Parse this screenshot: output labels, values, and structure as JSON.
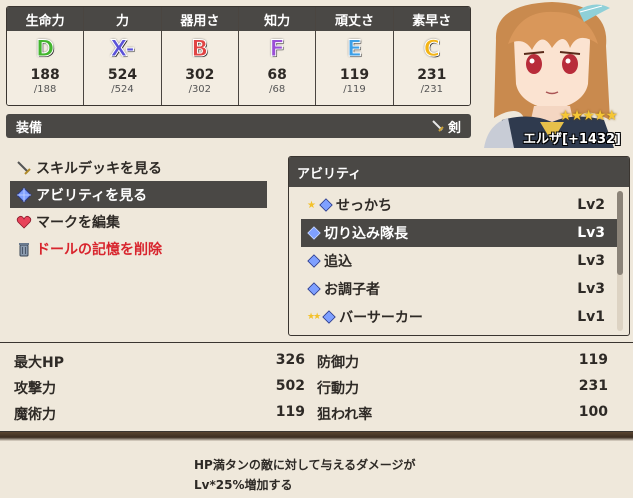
{
  "stats": [
    {
      "label": "生命力",
      "grade": "D",
      "grade_color": "#43b52e",
      "value": "188",
      "max": "/188"
    },
    {
      "label": "力",
      "grade": "X-",
      "grade_color": "#5b52d8",
      "value": "524",
      "max": "/524"
    },
    {
      "label": "器用さ",
      "grade": "B",
      "grade_color": "#e04444",
      "value": "302",
      "max": "/302"
    },
    {
      "label": "知力",
      "grade": "F",
      "grade_color": "#9a4fd6",
      "value": "68",
      "max": "/68"
    },
    {
      "label": "頑丈さ",
      "grade": "E",
      "grade_color": "#3c9fe6",
      "value": "119",
      "max": "/119"
    },
    {
      "label": "素早さ",
      "grade": "C",
      "grade_color": "#f3b416",
      "value": "231",
      "max": "/231"
    }
  ],
  "equipment": {
    "label": "装備",
    "value": "剣",
    "icon": "sword-icon"
  },
  "character": {
    "name": "エルザ[+1432]",
    "stars": "★★★★★",
    "star_count": 5
  },
  "menu": [
    {
      "label": "スキルデッキを見る",
      "icon": "sword-icon",
      "selected": false
    },
    {
      "label": "アビリティを見る",
      "icon": "diamond-icon",
      "selected": true
    },
    {
      "label": "マークを編集",
      "icon": "heart-icon",
      "selected": false
    },
    {
      "label": "ドールの記憶を削除",
      "icon": "trash-icon",
      "selected": false
    }
  ],
  "ability_panel": {
    "title": "アビリティ",
    "items": [
      {
        "name": "せっかち",
        "level": "Lv2",
        "badge": "★",
        "selected": false
      },
      {
        "name": "切り込み隊長",
        "level": "Lv3",
        "badge": "",
        "selected": true
      },
      {
        "name": "追込",
        "level": "Lv3",
        "badge": "",
        "selected": false
      },
      {
        "name": "お調子者",
        "level": "Lv3",
        "badge": "",
        "selected": false
      },
      {
        "name": "バーサーカー",
        "level": "Lv1",
        "badge": "★★",
        "selected": false
      }
    ]
  },
  "bottom_stats": [
    [
      {
        "label": "最大HP",
        "value": "326"
      },
      {
        "label": "防御力",
        "value": "119"
      }
    ],
    [
      {
        "label": "攻撃力",
        "value": "502"
      },
      {
        "label": "行動力",
        "value": "231"
      }
    ],
    [
      {
        "label": "魔術力",
        "value": "119"
      },
      {
        "label": "狙われ率",
        "value": "100"
      }
    ]
  ],
  "description": {
    "line1": "HP満タンの敵に対して与えるダメージが",
    "line2": "Lv*25%増加する"
  },
  "colors": {
    "dark_bar": "#4a4845",
    "background": "#efe8db",
    "danger": "#d8242d",
    "star": "#f6c735"
  }
}
